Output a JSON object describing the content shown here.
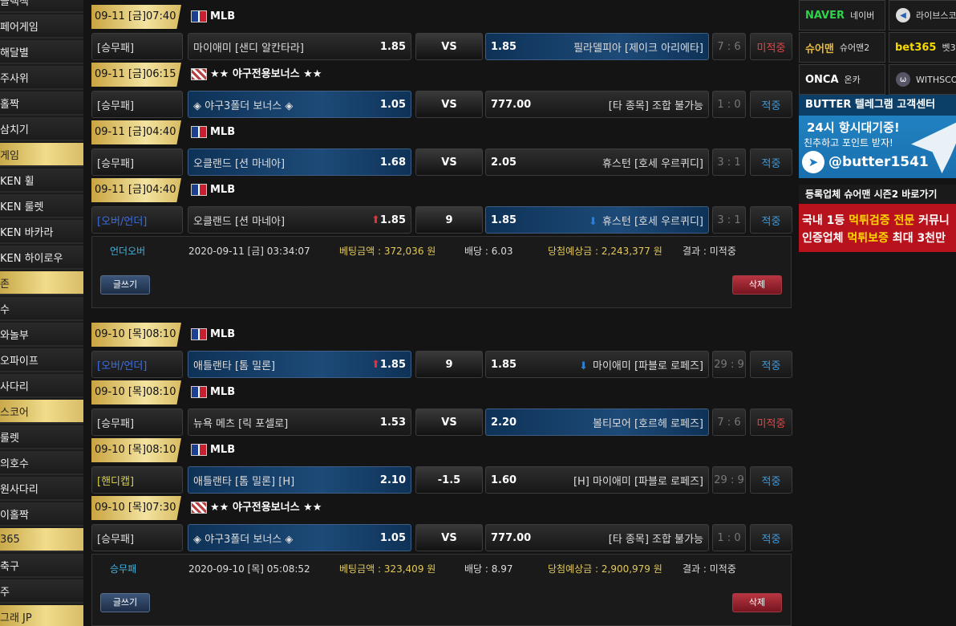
{
  "sidebar": {
    "items": [
      {
        "label": "블랙잭",
        "highlight": false
      },
      {
        "label": "페어게임",
        "highlight": false
      },
      {
        "label": "해달별",
        "highlight": false
      },
      {
        "label": "주사위",
        "highlight": false
      },
      {
        "label": "홀짝",
        "highlight": false
      },
      {
        "label": "삼치기",
        "highlight": false
      },
      {
        "label": "게임",
        "highlight": true
      },
      {
        "label": "KEN 휠",
        "highlight": false
      },
      {
        "label": "KEN 룰렛",
        "highlight": false
      },
      {
        "label": "KEN 바카라",
        "highlight": false
      },
      {
        "label": "KEN 하이로우",
        "highlight": false
      },
      {
        "label": "존",
        "highlight": true
      },
      {
        "label": "수",
        "highlight": false
      },
      {
        "label": "와놀부",
        "highlight": false
      },
      {
        "label": "오파이프",
        "highlight": false
      },
      {
        "label": "사다리",
        "highlight": false
      },
      {
        "label": "스코어",
        "highlight": true
      },
      {
        "label": "룰렛",
        "highlight": false
      },
      {
        "label": "의호수",
        "highlight": false
      },
      {
        "label": "원사다리",
        "highlight": false
      },
      {
        "label": "이홀짝",
        "highlight": false
      },
      {
        "label": "365",
        "highlight": true
      },
      {
        "label": "축구",
        "highlight": false
      },
      {
        "label": "주",
        "highlight": false
      },
      {
        "label": "그래 JP",
        "highlight": true
      }
    ]
  },
  "colors": {
    "gold": "#e6cf7c",
    "selected_blue": "#1d4a78",
    "pending_red": "#e04646",
    "hit_blue": "#3f97d6",
    "handicap_yellow": "#d8cf45",
    "type_blue": "#3b6ee3"
  },
  "groups": [
    {
      "headers": [
        {
          "time": "09-11 [금]07:40",
          "league_icon": "mlb-logo-icon",
          "league": "MLB"
        },
        {
          "time": "09-11 [금]06:15",
          "league_icon": "bonus-logo-icon",
          "league": "★★ 야구전용보너스 ★★"
        },
        {
          "time": "09-11 [금]04:40",
          "league_icon": "mlb-logo-icon",
          "league": "MLB"
        },
        {
          "time": "09-11 [금]04:40",
          "league_icon": "mlb-logo-icon",
          "league": "MLB"
        }
      ],
      "bets": [
        {
          "type": "[승무패]",
          "home": "마이애미 [샌디 알칸타라]",
          "home_odds": "1.85",
          "mid": "VS",
          "away_odds": "1.85",
          "away": "필라델피아 [제이크 아리에타]",
          "score": "7 : 6",
          "result": "미적중",
          "selected": "away"
        },
        {
          "type": "[승무패]",
          "home": "◈ 야구3폴더 보너스 ◈",
          "home_odds": "1.05",
          "mid": "VS",
          "away_odds": "777.00",
          "away": "[타 종목] 조합 불가능",
          "score": "1 : 0",
          "result": "적중",
          "selected": "home"
        },
        {
          "type": "[승무패]",
          "home": "오클랜드 [션 마네아]",
          "home_odds": "1.68",
          "mid": "VS",
          "away_odds": "2.05",
          "away": "휴스턴 [호세 우르퀴디]",
          "score": "3 : 1",
          "result": "적중",
          "selected": "home"
        },
        {
          "type": "[오버/언더]",
          "home": "오클랜드 [션 마네아]",
          "home_odds": "1.85",
          "mid": "9",
          "away_odds": "1.85",
          "away": "휴스턴 [호세 우르퀴디]",
          "score": "3 : 1",
          "result": "적중",
          "selected": "away"
        }
      ],
      "summary": {
        "result_type": "언더오버",
        "date": "2020-09-11 [금] 03:34:07",
        "amount": "베팅금액 : 372,036 원",
        "odds": "배당 : 6.03",
        "expected": "당첨예상금 : 2,243,377 원",
        "result": "결과 : 미적중"
      },
      "write_label": "글쓰기",
      "delete_label": "삭제"
    },
    {
      "headers": [
        {
          "time": "09-10 [목]08:10",
          "league_icon": "mlb-logo-icon",
          "league": "MLB"
        },
        {
          "time": "09-10 [목]08:10",
          "league_icon": "mlb-logo-icon",
          "league": "MLB"
        },
        {
          "time": "09-10 [목]08:10",
          "league_icon": "mlb-logo-icon",
          "league": "MLB"
        },
        {
          "time": "09-10 [목]07:30",
          "league_icon": "bonus-logo-icon",
          "league": "★★ 야구전용보너스 ★★"
        }
      ],
      "bets": [
        {
          "type": "[오버/언더]",
          "home": "애틀랜타 [톰 밀론]",
          "home_odds": "1.85",
          "mid": "9",
          "away_odds": "1.85",
          "away": "마이애미 [파블로 로페즈]",
          "score": "29 : 9",
          "result": "적중",
          "selected": "home"
        },
        {
          "type": "[승무패]",
          "home": "뉴욕 메츠 [릭 포셀로]",
          "home_odds": "1.53",
          "mid": "VS",
          "away_odds": "2.20",
          "away": "볼티모어 [호르헤 로페즈]",
          "score": "7 : 6",
          "result": "미적중",
          "selected": "away"
        },
        {
          "type": "[핸디캡]",
          "home": "애틀랜타 [톰 밀론] [H]",
          "home_odds": "2.10",
          "mid": "-1.5",
          "away_odds": "1.60",
          "away": "[H] 마이애미 [파블로 로페즈]",
          "score": "29 : 9",
          "result": "적중",
          "selected": "home"
        },
        {
          "type": "[승무패]",
          "home": "◈ 야구3폴더 보너스 ◈",
          "home_odds": "1.05",
          "mid": "VS",
          "away_odds": "777.00",
          "away": "[타 종목] 조합 불가능",
          "score": "1 : 0",
          "result": "적중",
          "selected": "home"
        }
      ],
      "summary": {
        "result_type": "승무패",
        "date": "2020-09-10 [목] 05:08:52",
        "amount": "베팅금액 : 323,409 원",
        "odds": "배당 : 8.97",
        "expected": "당첨예상금 : 2,900,979 원",
        "result": "결과 : 미적중"
      },
      "write_label": "글쓰기",
      "delete_label": "삭제"
    }
  ],
  "right_panel": {
    "partners": [
      {
        "brand": "NAVER",
        "name": "네이버",
        "brand_color": "#2fd24a",
        "icon": ""
      },
      {
        "brand": "",
        "name": "라이브스코",
        "brand_color": "#ffffff",
        "icon": "livescore-icon"
      },
      {
        "brand": "슈어맨",
        "name": "슈어맨2",
        "brand_color": "#e8b93a",
        "icon": ""
      },
      {
        "brand": "bet365",
        "name": "벳3",
        "brand_color": "#f6d900",
        "icon": ""
      },
      {
        "brand": "ONCA",
        "name": "온카",
        "brand_color": "#ffffff",
        "icon": ""
      },
      {
        "brand": "",
        "name": "WITHSCO",
        "brand_color": "#ffffff",
        "icon": "withscore-icon"
      }
    ],
    "telegram": {
      "title": "BUTTER 텔레그램 고객센터",
      "line1": "24시 항시대기중!",
      "line2": "친추하고 포인트 받자!",
      "handle": "@butter1541"
    },
    "sureman": {
      "title": "등록업체 슈어맨 시즌2 바로가기",
      "line1_a": "국내 1등 ",
      "line1_b": "먹튀검증 전문",
      "line1_c": " 커뮤니",
      "line2_a": "인증업체 ",
      "line2_b": "먹튀보증",
      "line2_c": " 최대 3천만"
    }
  }
}
